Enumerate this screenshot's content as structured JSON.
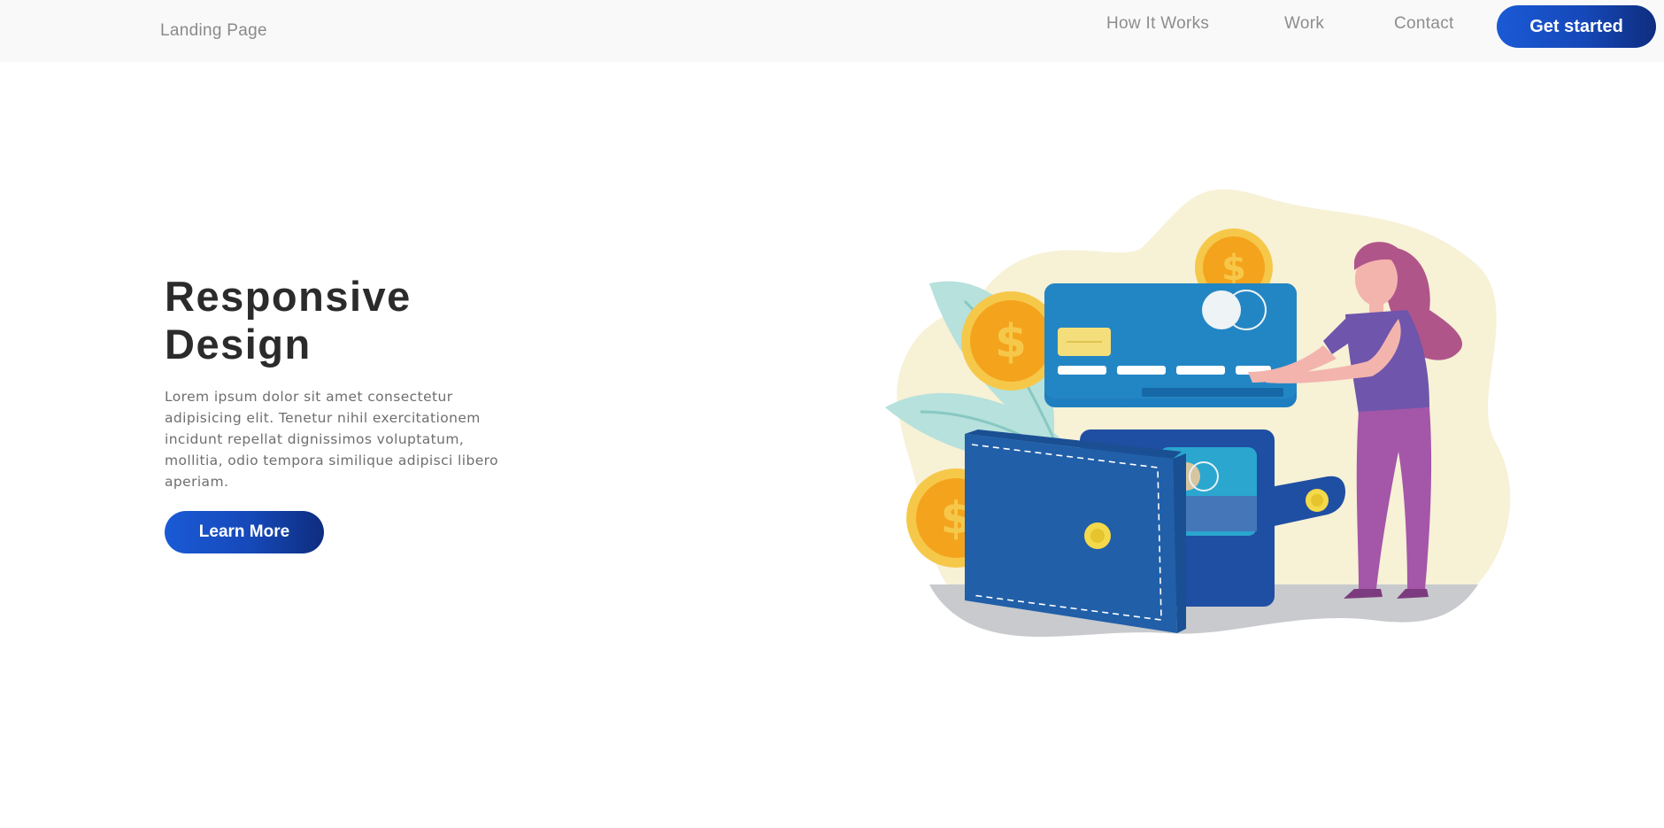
{
  "navbar": {
    "brand": "Landing Page",
    "links": [
      "How It Works",
      "Work",
      "Contact"
    ],
    "cta_label": "Get started"
  },
  "hero": {
    "title": "Responsive Design",
    "description": "Lorem ipsum dolor sit amet consectetur adipisicing elit. Tenetur nihil exercitationem incidunt repellat dignissimos voluptatum, mollitia, odio tempora similique adipisci libero aperiam.",
    "button_label": "Learn More"
  },
  "colors": {
    "accent_blue": "#1a5ad6",
    "accent_navy": "#0e2d7e",
    "navbar_bg": "#f9f9f9",
    "title_text": "#2b2b2b",
    "body_text": "#6e6e6e"
  },
  "illustration": {
    "icons": [
      "wallet-icon",
      "credit-card-icon",
      "coin-icon",
      "person-icon",
      "plant-icon"
    ]
  }
}
